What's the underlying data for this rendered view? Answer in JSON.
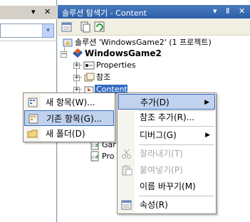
{
  "left_pane": {
    "pin_glyph": "▾",
    "close_glyph": "✕",
    "combo_arrow": "▾"
  },
  "solution_explorer": {
    "title": "솔루션 탐색기 - Content",
    "title_controls": {
      "dropdown": "▾",
      "pin": "Ⅱ",
      "close": "✕"
    },
    "tree": {
      "solution": "솔루션 'WindowsGame2' (1 프로젝트)",
      "project": "WindowsGame2",
      "properties": "Properties",
      "references": "참조",
      "content": "Content",
      "partial_item_1": "Gar",
      "partial_item_2": "Pro"
    }
  },
  "left_submenu": {
    "items": [
      {
        "label": "새 항목(W)...",
        "icon": "new-item-icon"
      },
      {
        "label": "기존 항목(G)...",
        "icon": "existing-item-icon",
        "highlighted": true
      },
      {
        "label": "새 폴더(D)",
        "icon": "new-folder-icon"
      }
    ]
  },
  "context_menu": {
    "items": [
      {
        "label": "추가(D)",
        "submenu": true,
        "highlighted": true
      },
      {
        "label": "참조 추가(R)..."
      },
      {
        "label": "디버그(G)",
        "submenu": true
      },
      {
        "label": "잘라내기(T)",
        "disabled": true,
        "icon": "scissors-icon"
      },
      {
        "label": "붙여넣기(P)",
        "disabled": true,
        "icon": "paste-icon"
      },
      {
        "label": "이름 바꾸기(M)"
      },
      {
        "label": "속성(R)",
        "icon": "properties-icon"
      }
    ],
    "arrow_glyph": "▶"
  },
  "colors": {
    "accent": "#316ac5",
    "highlight": "#c1d2ee",
    "title_bar": "#2c5fa8"
  }
}
